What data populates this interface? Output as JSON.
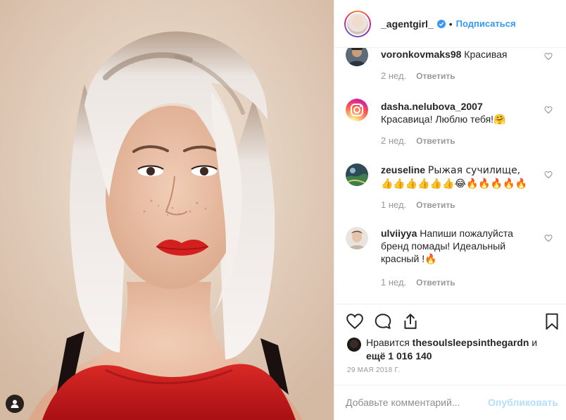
{
  "post": {
    "photo_icon": "woman-portrait-photo",
    "user_tag_icon": "user-silhouette-icon"
  },
  "header": {
    "username": "_agentgirl_",
    "separator": "•",
    "follow_label": "Подписаться",
    "verified_icon": "verified-badge-icon"
  },
  "comments": [
    {
      "username": "voronkovmaks98",
      "text": "Красивая",
      "time": "2 нед.",
      "reply_label": "Ответить",
      "avatar_icon": "avatar-photo"
    },
    {
      "username": "dasha.nelubova_2007",
      "text": "Красавица! Люблю тебя!🤗",
      "time": "2 нед.",
      "reply_label": "Ответить",
      "avatar_icon": "instagram-logo-avatar"
    },
    {
      "username": "zeuseline",
      "text": "Рыжая сучилище, 👍👍👍👍👍👍😂🔥🔥🔥🔥🔥",
      "time": "1 нед.",
      "reply_label": "Ответить",
      "avatar_icon": "avatar-photo"
    },
    {
      "username": "ulviiyya",
      "text": "Напиши пожалуйста бренд помады! Идеальный красный !🔥",
      "time": "1 нед.",
      "reply_label": "Ответить",
      "avatar_icon": "avatar-photo"
    }
  ],
  "actions": {
    "like_icon": "heart-icon",
    "comment_icon": "comment-bubble-icon",
    "share_icon": "share-icon",
    "save_icon": "bookmark-icon"
  },
  "likes": {
    "prefix": "Нравится ",
    "liker": "thesoulsleepsinthegardn",
    "middle": " и ",
    "more": "ещё 1 016 140"
  },
  "post_date": "29 МАЯ 2018 Г.",
  "add_comment": {
    "placeholder": "Добавьте комментарий...",
    "publish_label": "Опубликовать"
  },
  "colors": {
    "accent": "#3897f0",
    "publish_disabled": "#b2dffc",
    "lipstick": "#d3201f",
    "dress": "#c9181b"
  }
}
